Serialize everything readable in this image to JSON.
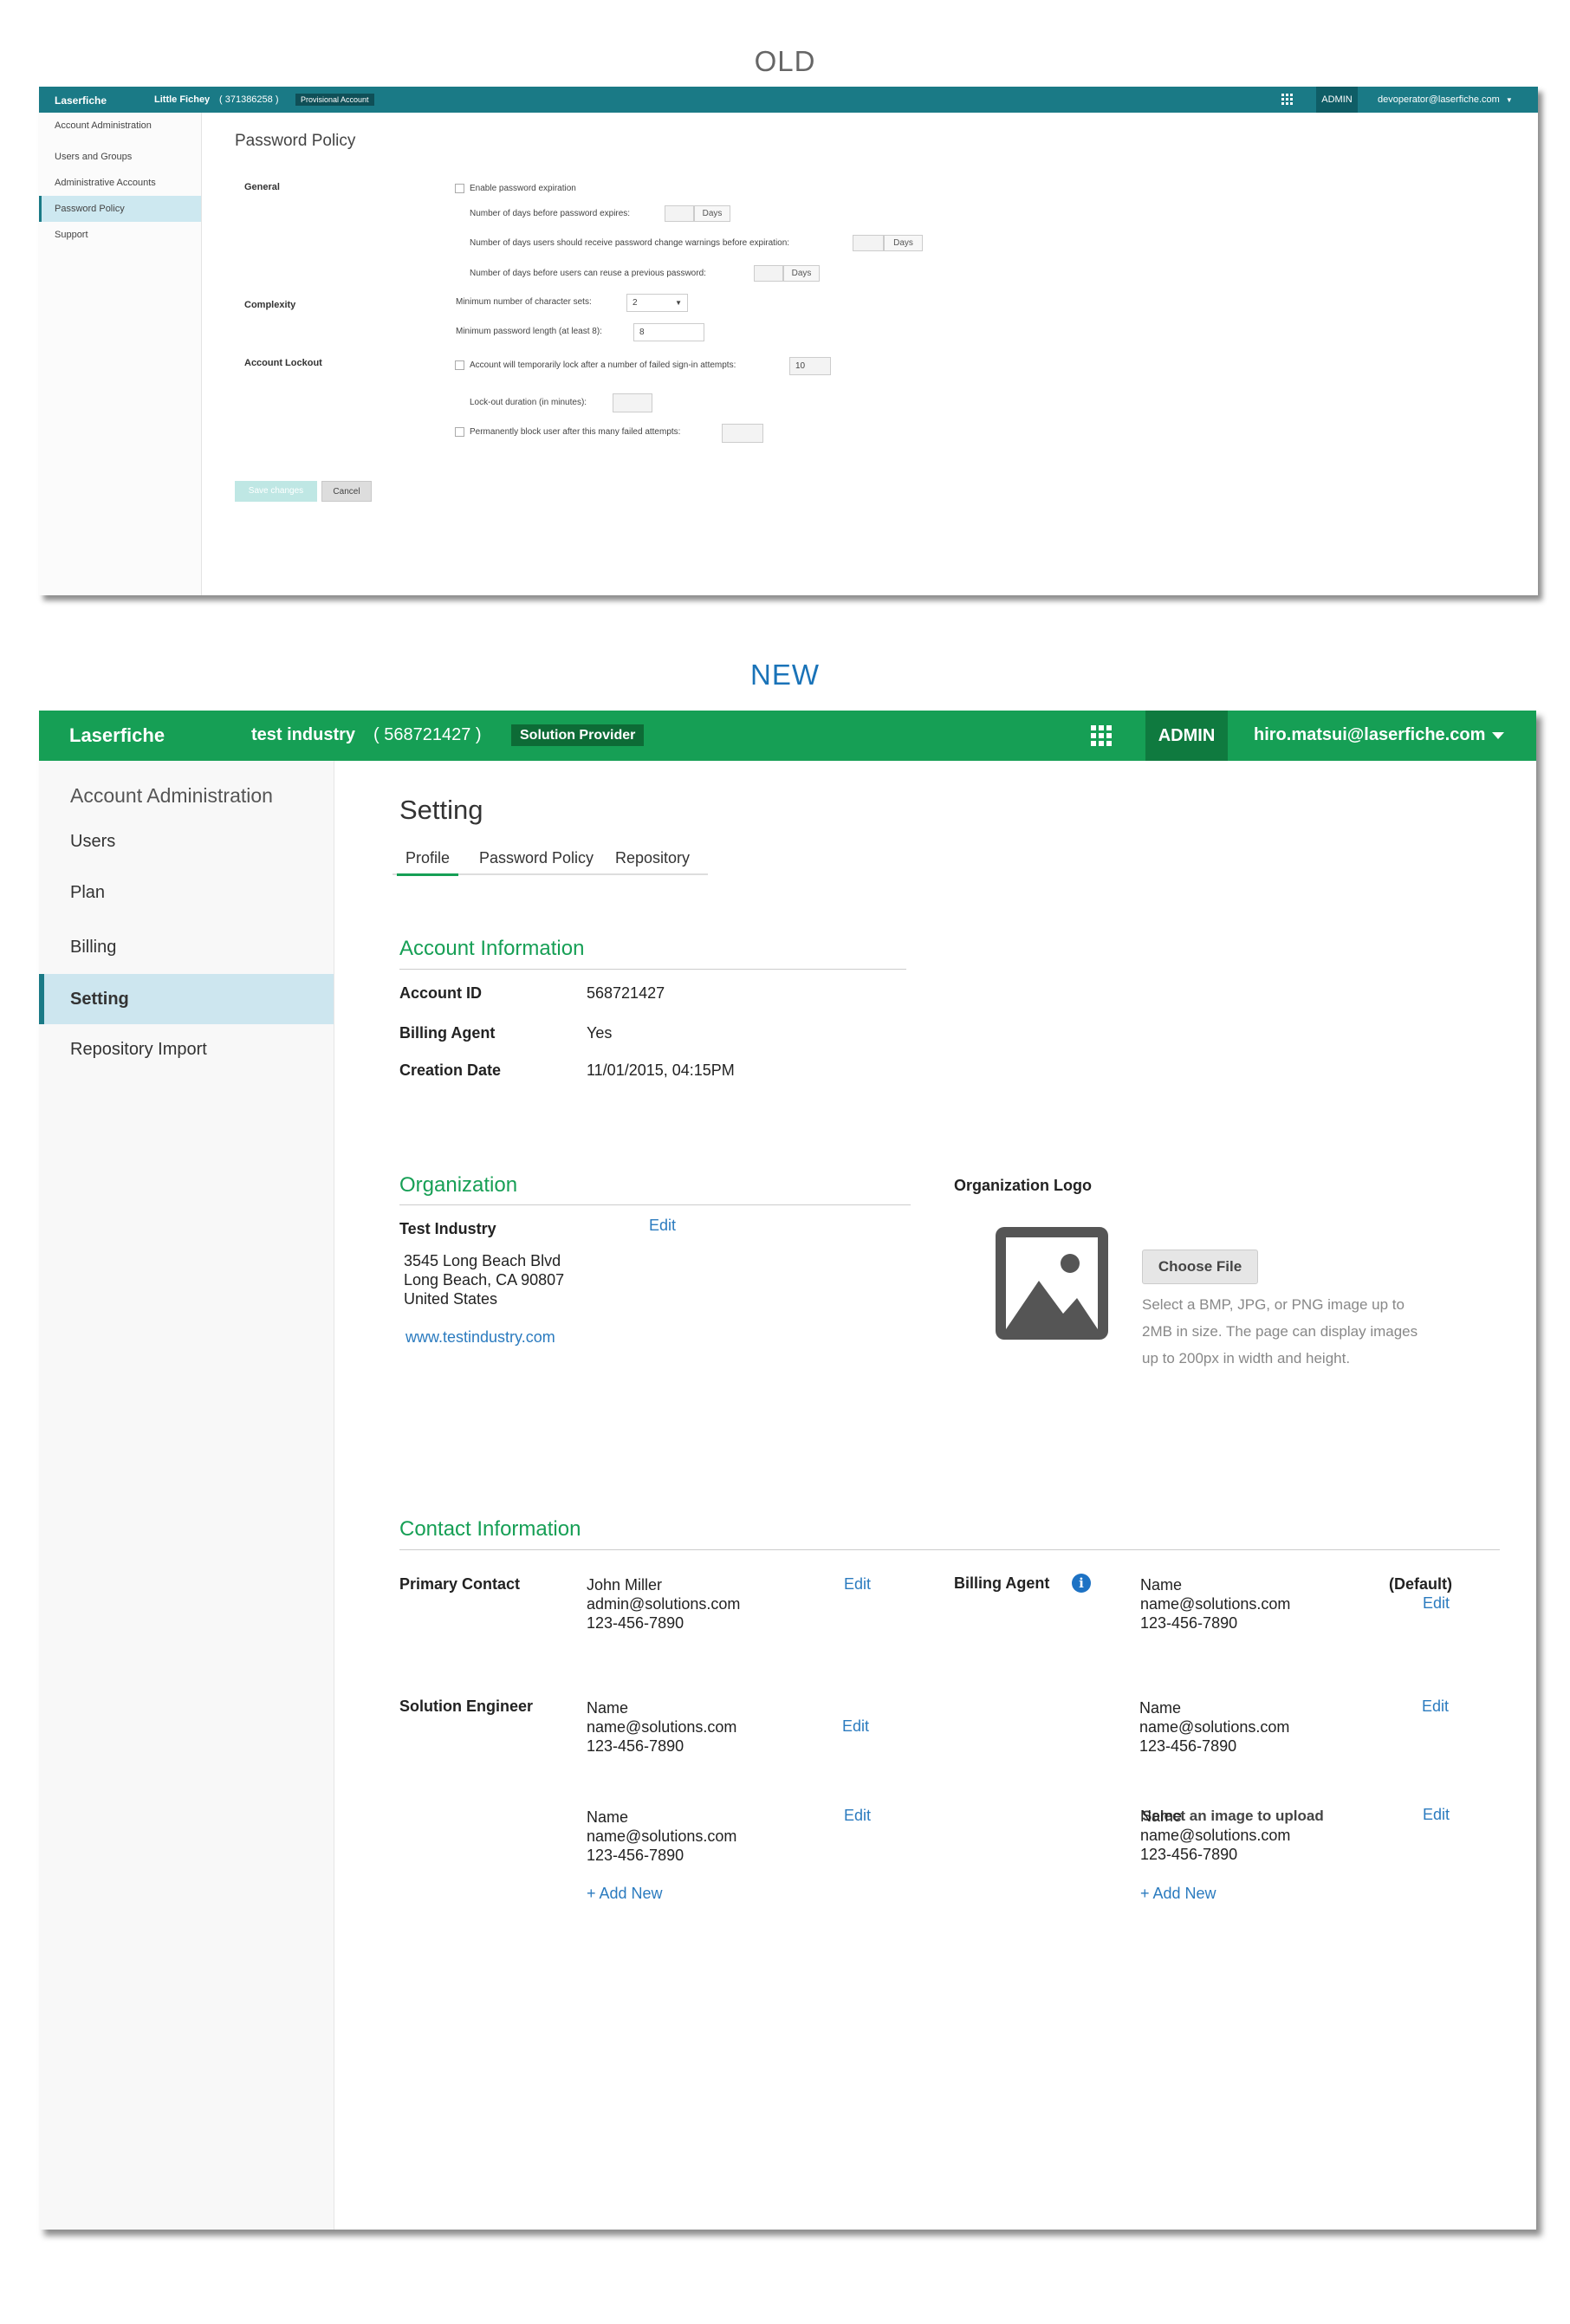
{
  "captions": {
    "old": "OLD",
    "new": "NEW"
  },
  "old": {
    "topbar": {
      "logo": "Laserfiche",
      "account_name": "Little Fichey",
      "account_id": "( 371386258 )",
      "badge": "Provisional Account",
      "admin": "ADMIN",
      "user": "devoperator@laserfiche.com"
    },
    "sidebar": {
      "heading": "Account Administration",
      "items": [
        {
          "label": "Users and Groups"
        },
        {
          "label": "Administrative Accounts"
        },
        {
          "label": "Password Policy",
          "active": true
        },
        {
          "label": "Support"
        }
      ]
    },
    "page_title": "Password Policy",
    "sections": {
      "general": "General",
      "complexity": "Complexity",
      "lockout": "Account Lockout"
    },
    "general": {
      "enable_label": "Enable password expiration",
      "expire_label": "Number of days before password expires:",
      "warning_label": "Number of days users should receive password change warnings before expiration:",
      "reuse_label": "Number of days before users can reuse a previous password:",
      "days_label": "Days"
    },
    "complexity": {
      "charsets_label": "Minimum number of character sets:",
      "charsets_value": "2",
      "length_label": "Minimum password length (at least 8):",
      "length_value": "8"
    },
    "lockout": {
      "temp_lock_label": "Account will temporarily lock after a number of failed sign-in attempts:",
      "temp_lock_value": "10",
      "duration_label": "Lock-out duration (in minutes):",
      "perm_block_label": "Permanently block user after this many failed attempts:"
    },
    "buttons": {
      "save": "Save changes",
      "cancel": "Cancel"
    }
  },
  "new": {
    "topbar": {
      "logo": "Laserfiche",
      "account_name": "test industry",
      "account_id": "( 568721427 )",
      "badge": "Solution Provider",
      "admin": "ADMIN",
      "user": "hiro.matsui@laserfiche.com"
    },
    "sidebar": {
      "heading": "Account Administration",
      "items": [
        {
          "label": "Users"
        },
        {
          "label": "Plan"
        },
        {
          "label": "Billing"
        },
        {
          "label": "Setting",
          "active": true
        },
        {
          "label": "Repository Import"
        }
      ]
    },
    "page_title": "Setting",
    "tabs": [
      {
        "label": "Profile",
        "active": true
      },
      {
        "label": "Password Policy"
      },
      {
        "label": "Repository"
      }
    ],
    "account_info": {
      "heading": "Account  Information",
      "account_id_label": "Account ID",
      "account_id_value": "568721427",
      "billing_agent_label": "Billing Agent",
      "billing_agent_value": "Yes",
      "creation_date_label": "Creation Date",
      "creation_date_value": "11/01/2015,  04:15PM"
    },
    "organization": {
      "heading": "Organization",
      "name": "Test Industry",
      "edit": "Edit",
      "address_line1": "3545 Long Beach Blvd",
      "address_line2": "Long Beach, CA 90807",
      "address_line3": "United States",
      "website": "www.testindustry.com"
    },
    "logo": {
      "heading": "Organization Logo",
      "icon": "image-placeholder-icon",
      "prompt": "Select an image to upload",
      "button": "Choose File",
      "help": "Select a BMP, JPG, or PNG image up to 2MB in size. The page can display images up to 200px in width and height."
    },
    "contact": {
      "heading": "Contact Information",
      "primary_label": "Primary Contact",
      "primary": {
        "name": "John Miller",
        "email": "admin@solutions.com",
        "phone": "123-456-7890",
        "edit": "Edit"
      },
      "billing_label": "Billing Agent",
      "billing_default": "(Default)",
      "billing": [
        {
          "name": "Name",
          "email": "name@solutions.com",
          "phone": "123-456-7890",
          "edit": "Edit"
        },
        {
          "name": "Name",
          "email": "name@solutions.com",
          "phone": "123-456-7890",
          "edit": "Edit"
        },
        {
          "name": "Name",
          "email": "name@solutions.com",
          "phone": "123-456-7890",
          "edit": "Edit"
        }
      ],
      "engineer_label": "Solution Engineer",
      "engineers": [
        {
          "name": "Name",
          "email": "name@solutions.com",
          "phone": "123-456-7890",
          "edit": "Edit"
        },
        {
          "name": "Name",
          "email": "name@solutions.com",
          "phone": "123-456-7890",
          "edit": "Edit"
        }
      ],
      "add_new": "+ Add New"
    }
  },
  "colors": {
    "old_teal": "#1a7a86",
    "new_green": "#169f55",
    "link_blue": "#2b7bbf",
    "active_item_bg": "#cde6ef"
  }
}
